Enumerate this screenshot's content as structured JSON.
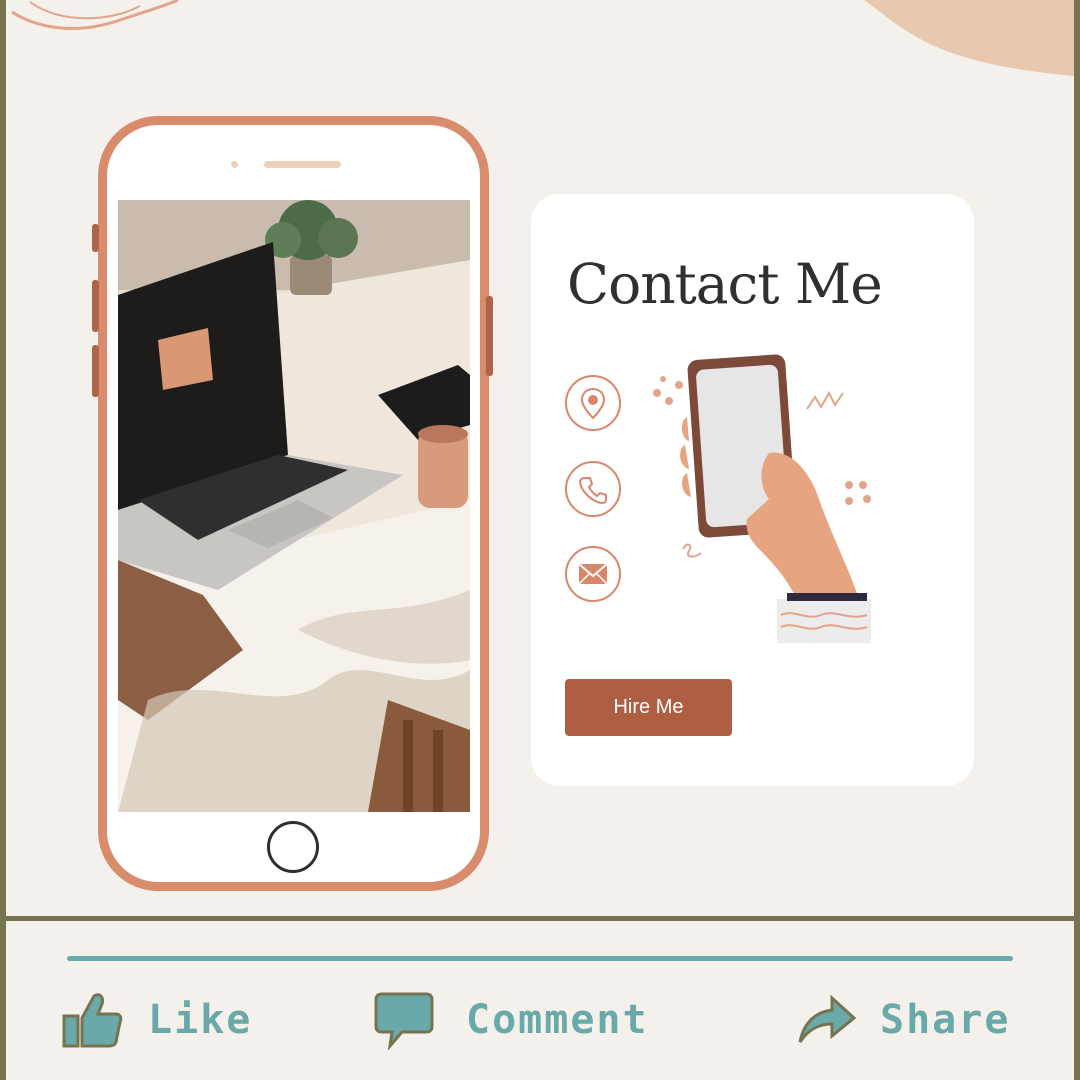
{
  "card": {
    "title": "Contact Me",
    "hire_button": "Hire Me",
    "icons": [
      "location-pin-icon",
      "phone-icon",
      "mail-icon"
    ]
  },
  "social": {
    "like_label": "Like",
    "comment_label": "Comment",
    "share_label": "Share"
  },
  "colors": {
    "background": "#f4f1ec",
    "phone_frame": "#d98c6c",
    "accent_brown": "#ad5e43",
    "teal": "#6aa9a9",
    "border": "#77734f"
  }
}
